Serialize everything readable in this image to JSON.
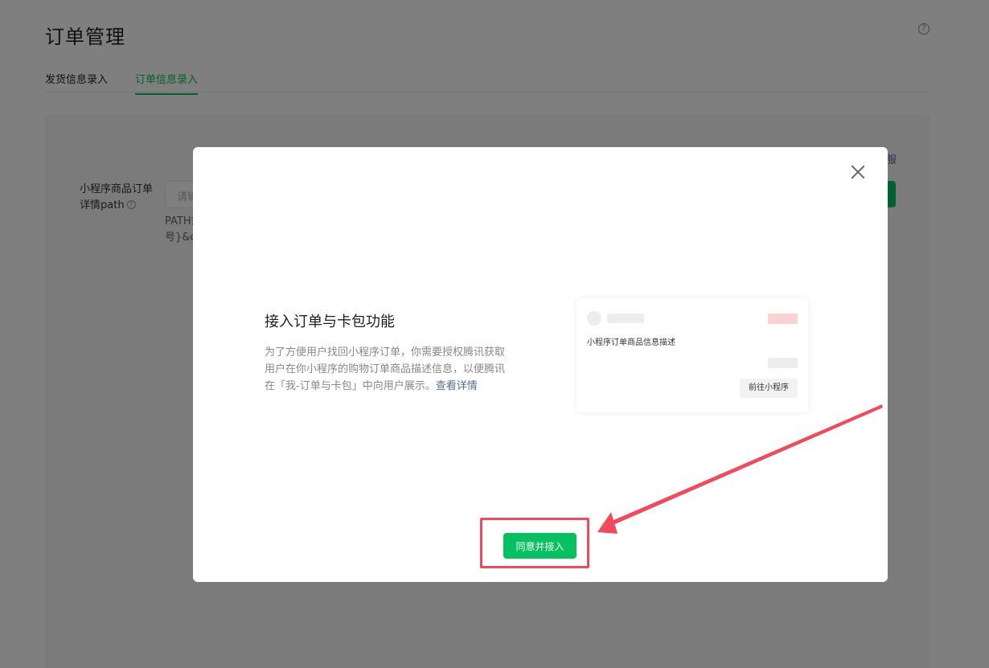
{
  "page": {
    "title": "订单管理",
    "help": "?",
    "tabs": [
      {
        "label": "发货信息录入",
        "active": false
      },
      {
        "label": "订单信息录入",
        "active": true
      }
    ],
    "form": {
      "label": "小程序商品订单详情path",
      "label_line1": "小程序商品订单",
      "label_line2": "详情path",
      "help": "?",
      "input_placeholder": "请输",
      "hint_line1": "PATH需",
      "hint_line2": "号}&c"
    },
    "side_link": "服"
  },
  "modal": {
    "title": "接入订单与卡包功能",
    "description": "为了方便用户找回小程序订单，你需要授权腾讯获取用户在你小程序的购物订单商品描述信息，以便腾讯在「我-订单与卡包」中向用户展示。",
    "detail_link": "查看详情",
    "preview": {
      "item_text": "小程序订单商品信息描述",
      "button_label": "前往小程序"
    },
    "primary_button": "同意并接入"
  },
  "colors": {
    "brand_green": "#07c160",
    "annotation_red": "#f24a5c",
    "link_blue": "#576b95"
  }
}
